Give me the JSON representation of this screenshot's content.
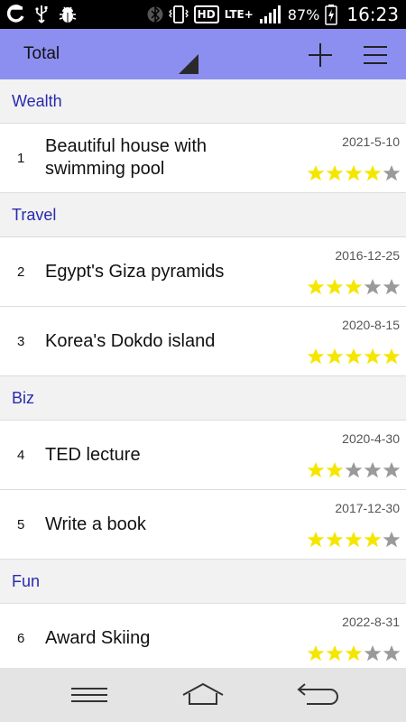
{
  "status_bar": {
    "icons_left": [
      "carrier-logo-icon",
      "usb-icon",
      "debug-bug-icon"
    ],
    "icons_right": [
      "bluetooth-icon",
      "vibrate-icon",
      "hd-voice-icon",
      "lte-icon",
      "signal-icon",
      "battery-charging-icon"
    ],
    "hd_label": "HD",
    "lte_label": "LTE+",
    "battery_percent": "87%",
    "time": "16:23"
  },
  "app_bar": {
    "title": "Total",
    "add_icon": "plus-icon",
    "menu_icon": "hamburger-menu-icon"
  },
  "colors": {
    "app_bar_bg": "#8c8ff0",
    "section_text": "#2a2ab0",
    "star_filled": "#f5e600",
    "star_empty": "#9a9a9a"
  },
  "max_stars": 5,
  "sections": [
    {
      "title": "Wealth",
      "items": [
        {
          "num": "1",
          "title": "Beautiful house with swimming pool",
          "date": "2021-5-10",
          "rating": 4
        }
      ]
    },
    {
      "title": "Travel",
      "items": [
        {
          "num": "2",
          "title": "Egypt's Giza pyramids",
          "date": "2016-12-25",
          "rating": 3
        },
        {
          "num": "3",
          "title": "Korea's Dokdo island",
          "date": "2020-8-15",
          "rating": 5
        }
      ]
    },
    {
      "title": "Biz",
      "items": [
        {
          "num": "4",
          "title": "TED lecture",
          "date": "2020-4-30",
          "rating": 2
        },
        {
          "num": "5",
          "title": "Write a book",
          "date": "2017-12-30",
          "rating": 4
        }
      ]
    },
    {
      "title": "Fun",
      "items": [
        {
          "num": "6",
          "title": "Award Skiing",
          "date": "2022-8-31",
          "rating": 3
        }
      ]
    }
  ],
  "nav_bar": {
    "icons": [
      "menu-lines-icon",
      "home-icon",
      "back-icon"
    ]
  }
}
